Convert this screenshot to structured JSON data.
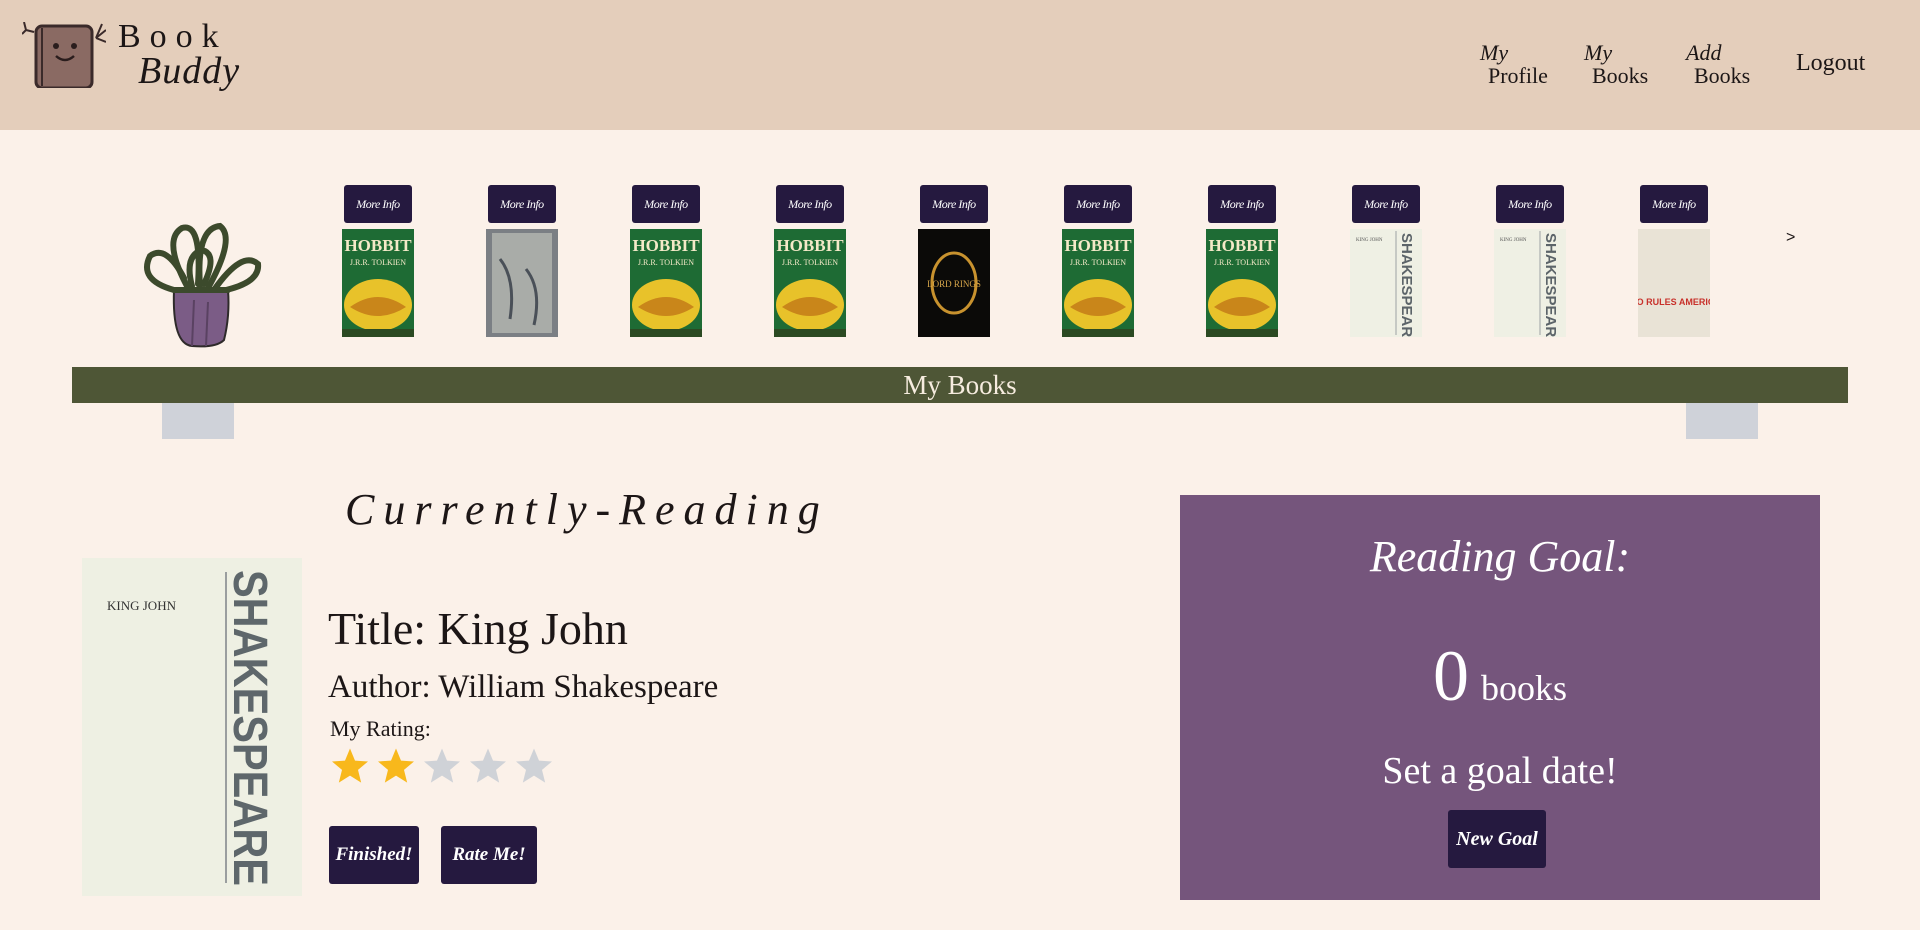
{
  "brand": {
    "line1": "Book",
    "line2": "Buddy"
  },
  "nav": [
    {
      "small": "My",
      "big": "Profile"
    },
    {
      "small": "My",
      "big": "Books"
    },
    {
      "small": "Add",
      "big": "Books"
    }
  ],
  "nav_logout": "Logout",
  "shelf": {
    "more_info_label": "More Info",
    "books": [
      {
        "title_text": "HOBBIT",
        "author_text": "J.R.R. TOLKIEN",
        "cover": "hobbit"
      },
      {
        "title_text": "",
        "author_text": "",
        "cover": "grey-illustrated"
      },
      {
        "title_text": "HOBBIT",
        "author_text": "J.R.R. TOLKIEN",
        "cover": "hobbit"
      },
      {
        "title_text": "HOBBIT",
        "author_text": "J.R.R. TOLKIEN",
        "cover": "hobbit"
      },
      {
        "title_text": "LORD RINGS",
        "author_text": "",
        "cover": "lotr"
      },
      {
        "title_text": "HOBBIT",
        "author_text": "J.R.R. TOLKIEN",
        "cover": "hobbit"
      },
      {
        "title_text": "HOBBIT",
        "author_text": "J.R.R. TOLKIEN",
        "cover": "hobbit"
      },
      {
        "title_text": "SHAKESPEARE",
        "author_text": "KING JOHN",
        "cover": "shakespeare"
      },
      {
        "title_text": "SHAKESPEARE",
        "author_text": "KING JOHN",
        "cover": "shakespeare"
      },
      {
        "title_text": "WHO RULES AMERICA?",
        "author_text": "",
        "cover": "who-rules"
      }
    ],
    "next_label": ">",
    "shelf_label": "My Books"
  },
  "currently_reading": {
    "heading": "Currently-Reading",
    "cover_small_text": "KING JOHN",
    "cover_big_text": "SHAKESPEARE",
    "title": "Title: King John",
    "author": "Author: William Shakespeare",
    "rating_label": "My Rating:",
    "rating": 2,
    "rating_max": 5,
    "finished_label": "Finished!",
    "rate_label": "Rate Me!"
  },
  "reading_goal": {
    "title": "Reading Goal:",
    "count": "0",
    "unit": "books",
    "cta": "Set a goal date!",
    "button_label": "New Goal"
  },
  "colors": {
    "header_bg": "#e4cebb",
    "page_bg": "#fbf1e9",
    "button": "#25193f",
    "shelf": "#4e5636",
    "goal_bg": "#75557c",
    "star_filled": "#f8b81c",
    "star_empty": "#cfd2d7"
  }
}
